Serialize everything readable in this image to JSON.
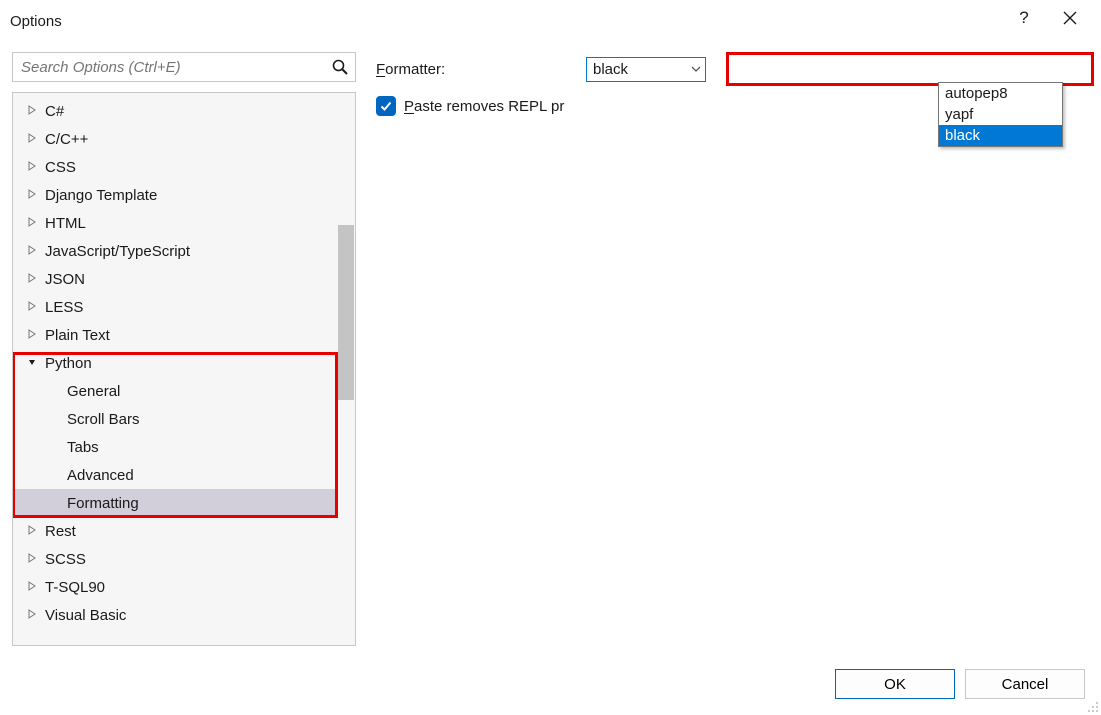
{
  "titlebar": {
    "title": "Options"
  },
  "search": {
    "placeholder": "Search Options (Ctrl+E)"
  },
  "tree": {
    "items": [
      {
        "label": "C#",
        "expanded": false,
        "level": 0
      },
      {
        "label": "C/C++",
        "expanded": false,
        "level": 0
      },
      {
        "label": "CSS",
        "expanded": false,
        "level": 0
      },
      {
        "label": "Django Template",
        "expanded": false,
        "level": 0
      },
      {
        "label": "HTML",
        "expanded": false,
        "level": 0
      },
      {
        "label": "JavaScript/TypeScript",
        "expanded": false,
        "level": 0
      },
      {
        "label": "JSON",
        "expanded": false,
        "level": 0
      },
      {
        "label": "LESS",
        "expanded": false,
        "level": 0
      },
      {
        "label": "Plain Text",
        "expanded": false,
        "level": 0
      },
      {
        "label": "Python",
        "expanded": true,
        "level": 0
      },
      {
        "label": "General",
        "level": 1
      },
      {
        "label": "Scroll Bars",
        "level": 1
      },
      {
        "label": "Tabs",
        "level": 1
      },
      {
        "label": "Advanced",
        "level": 1
      },
      {
        "label": "Formatting",
        "level": 1,
        "selected": true
      },
      {
        "label": "Rest",
        "expanded": false,
        "level": 0
      },
      {
        "label": "SCSS",
        "expanded": false,
        "level": 0
      },
      {
        "label": "T-SQL90",
        "expanded": false,
        "level": 0
      },
      {
        "label": "Visual Basic",
        "expanded": false,
        "level": 0
      }
    ]
  },
  "form": {
    "formatter_label_pre": "F",
    "formatter_label_post": "ormatter:",
    "formatter_value": "black",
    "formatter_options": [
      "autopep8",
      "yapf",
      "black"
    ],
    "formatter_selected": "black",
    "paste_label_pre": "P",
    "paste_label_post": "aste removes REPL pr",
    "paste_checked": true
  },
  "footer": {
    "ok": "OK",
    "cancel": "Cancel"
  }
}
